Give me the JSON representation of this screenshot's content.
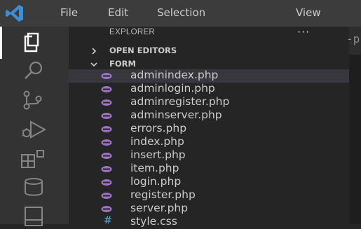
{
  "menubar": {
    "items": [
      {
        "label": "File"
      },
      {
        "label": "Edit"
      },
      {
        "label": "Selection"
      },
      {
        "label": "View"
      }
    ]
  },
  "activity_bar": {
    "icons": [
      "explorer-icon",
      "search-icon",
      "source-control-icon",
      "run-debug-icon",
      "extensions-icon",
      "database-icon",
      "panel-icon"
    ],
    "active": "explorer-icon"
  },
  "explorer": {
    "title": "EXPLORER",
    "more_actions": "···",
    "open_editors": {
      "label": "OPEN EDITORS",
      "expanded": false
    },
    "folder": {
      "label": "FORM",
      "expanded": true,
      "files": [
        {
          "name": "adminindex.php",
          "icon": "php-icon",
          "selected": true
        },
        {
          "name": "adminlogin.php",
          "icon": "php-icon"
        },
        {
          "name": "adminregister.php",
          "icon": "php-icon"
        },
        {
          "name": "adminserver.php",
          "icon": "php-icon"
        },
        {
          "name": "errors.php",
          "icon": "php-icon"
        },
        {
          "name": "index.php",
          "icon": "php-icon"
        },
        {
          "name": "insert.php",
          "icon": "php-icon"
        },
        {
          "name": "item.php",
          "icon": "php-icon"
        },
        {
          "name": "login.php",
          "icon": "php-icon"
        },
        {
          "name": "register.php",
          "icon": "php-icon"
        },
        {
          "name": "server.php",
          "icon": "php-icon"
        },
        {
          "name": "style.css",
          "icon": "css-icon",
          "glyph": "#"
        }
      ]
    }
  },
  "editor_tab_fragment": "-p",
  "colors": {
    "accent": "#3c8fd6",
    "php_icon": "#a074c4",
    "css_icon": "#519aba",
    "selected_row": "#37373d"
  }
}
